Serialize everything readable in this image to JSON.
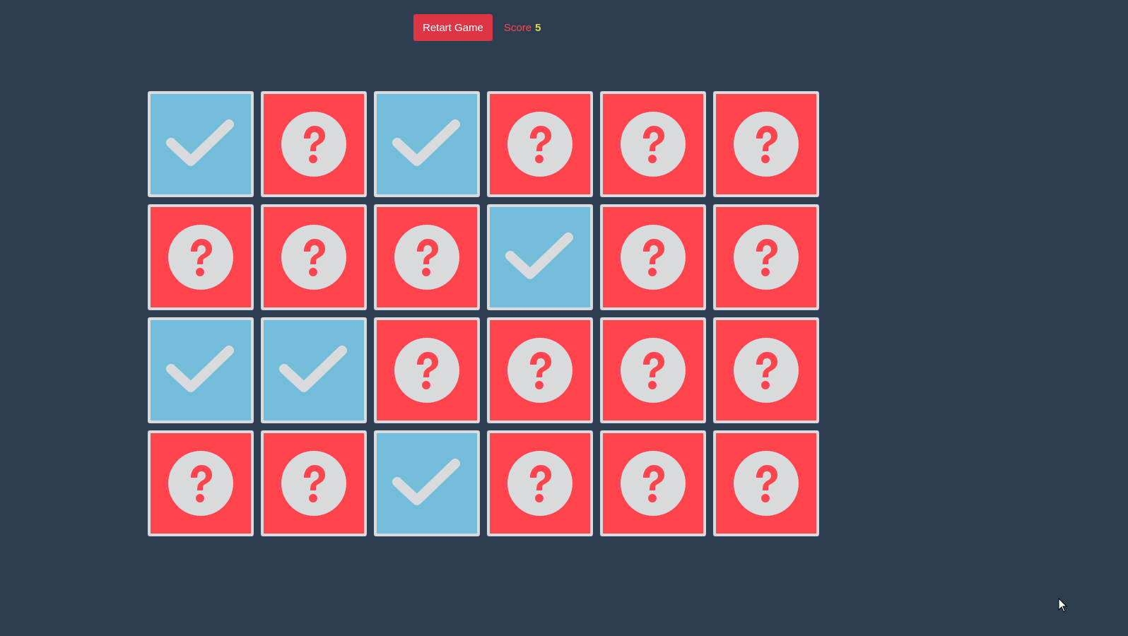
{
  "toolbar": {
    "restart_label": "Retart Game",
    "score_label": "Score",
    "score_value": "5"
  },
  "colors": {
    "background": "#2d3e50",
    "card_hidden": "#ff444e",
    "card_matched": "#73bddb",
    "icon": "#d8dadc",
    "button": "#dc3545"
  },
  "board": {
    "rows": [
      [
        "matched",
        "hidden",
        "matched",
        "hidden",
        "hidden",
        "hidden"
      ],
      [
        "hidden",
        "hidden",
        "hidden",
        "matched",
        "hidden",
        "hidden"
      ],
      [
        "matched",
        "matched",
        "hidden",
        "hidden",
        "hidden",
        "hidden"
      ],
      [
        "hidden",
        "hidden",
        "matched",
        "hidden",
        "hidden",
        "hidden"
      ]
    ],
    "icons": {
      "hidden": "question-circle-icon",
      "matched": "checkmark-icon"
    }
  }
}
